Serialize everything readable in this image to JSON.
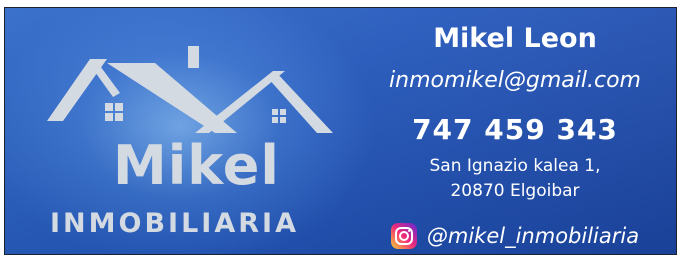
{
  "brand": {
    "name": "Mikel",
    "subtitle": "INMOBILIARIA"
  },
  "contact": {
    "name": "Mikel Leon",
    "email": "inmomikel@gmail.com",
    "phone": "747 459 343",
    "address_line1": "San Ignazio kalea 1,",
    "address_line2": "20870 Elgoibar",
    "instagram": "@mikel_inmobiliaria"
  },
  "icons": {
    "social": "instagram-icon",
    "logo": "house-roof-icon"
  },
  "colors": {
    "background": "#2458bd",
    "logo_gray": "#d4dae2",
    "text": "#ffffff",
    "instagram_gradient": [
      "#f9ce34",
      "#ee2a7b",
      "#6228d7"
    ]
  }
}
